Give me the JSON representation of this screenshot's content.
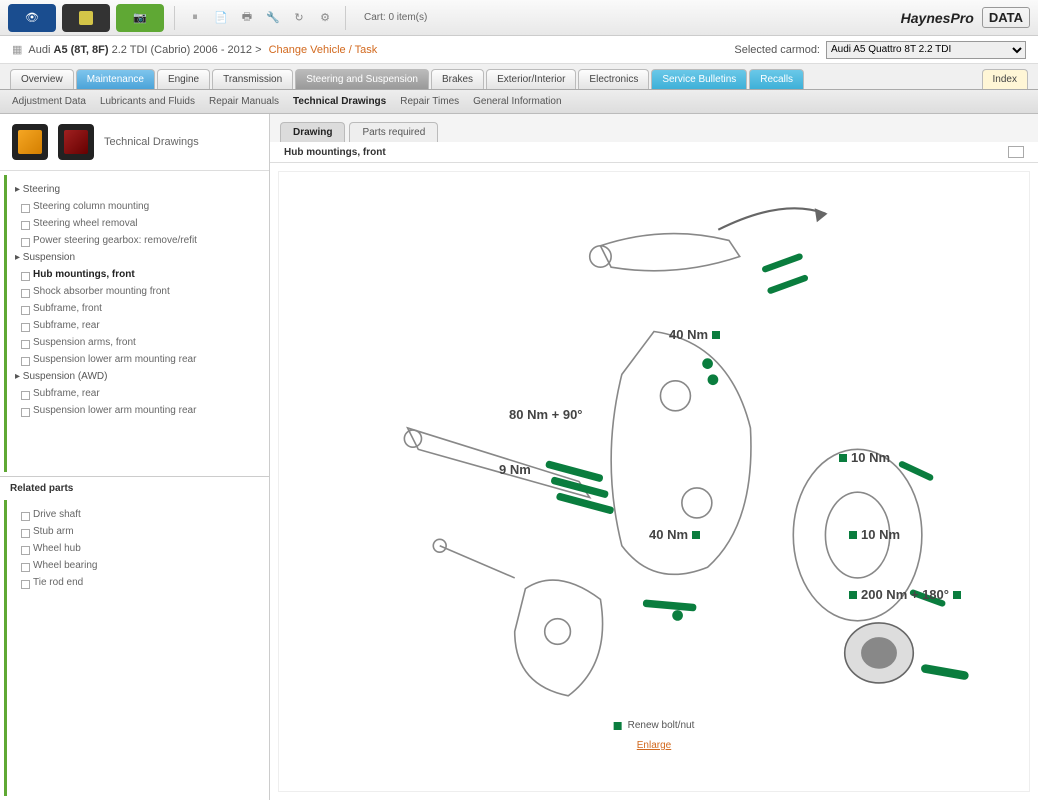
{
  "toolbar": {
    "cart_label": "Cart: 0 item(s)",
    "brand1": "HaynesPro",
    "brand2": "DATA"
  },
  "breadcrumb": {
    "prefix": "Audi",
    "model": "A5 (8T, 8F)",
    "variant": "2.2 TDI (Cabrio) 2006 - 2012",
    "sep": ">",
    "link": "Change Vehicle / Task",
    "selected_label": "Selected carmod:",
    "selected_value": "Audi A5 Quattro 8T 2.2 TDI"
  },
  "mainTabs": [
    {
      "label": "Overview"
    },
    {
      "label": "Maintenance",
      "type": "blue"
    },
    {
      "label": "Engine"
    },
    {
      "label": "Transmission"
    },
    {
      "label": "Steering and Suspension",
      "type": "active"
    },
    {
      "label": "Brakes"
    },
    {
      "label": "Exterior/Interior"
    },
    {
      "label": "Electronics"
    },
    {
      "label": "Service Bulletins",
      "type": "cyan"
    },
    {
      "label": "Recalls",
      "type": "cyan"
    },
    {
      "label": "Index",
      "type": "index"
    }
  ],
  "subTabs": [
    {
      "label": "Adjustment Data"
    },
    {
      "label": "Lubricants and Fluids"
    },
    {
      "label": "Repair Manuals"
    },
    {
      "label": "Technical Drawings",
      "active": true
    },
    {
      "label": "Repair Times"
    },
    {
      "label": "General Information"
    }
  ],
  "sidebar": {
    "title": "Technical Drawings",
    "groups": [
      {
        "name": "Steering",
        "items": [
          "Steering column mounting",
          "Steering wheel removal",
          "Power steering gearbox: remove/refit"
        ]
      },
      {
        "name": "Suspension",
        "items": [
          "Hub mountings, front",
          "Shock absorber mounting front",
          "Subframe, front",
          "Subframe, rear",
          "Suspension arms, front",
          "Suspension lower arm mounting rear"
        ],
        "activeIndex": 0
      },
      {
        "name": "Suspension (AWD)",
        "items": [
          "Subframe, rear",
          "Suspension lower arm mounting rear"
        ]
      }
    ],
    "related_header": "Related parts",
    "related": [
      "Drive shaft",
      "Stub arm",
      "Wheel hub",
      "Wheel bearing",
      "Tie rod end"
    ]
  },
  "mainArea": {
    "tabs": [
      {
        "label": "Drawing",
        "active": true
      },
      {
        "label": "Parts required"
      }
    ],
    "title": "Hub mountings, front",
    "torques": {
      "t1": "40 Nm",
      "t2": "80 Nm + 90°",
      "t3": "9 Nm",
      "t4": "10 Nm",
      "t5": "40 Nm",
      "t6": "10 Nm",
      "t7": "200 Nm + 180°"
    },
    "legend": "Renew bolt/nut",
    "enlarge": "Enlarge"
  }
}
